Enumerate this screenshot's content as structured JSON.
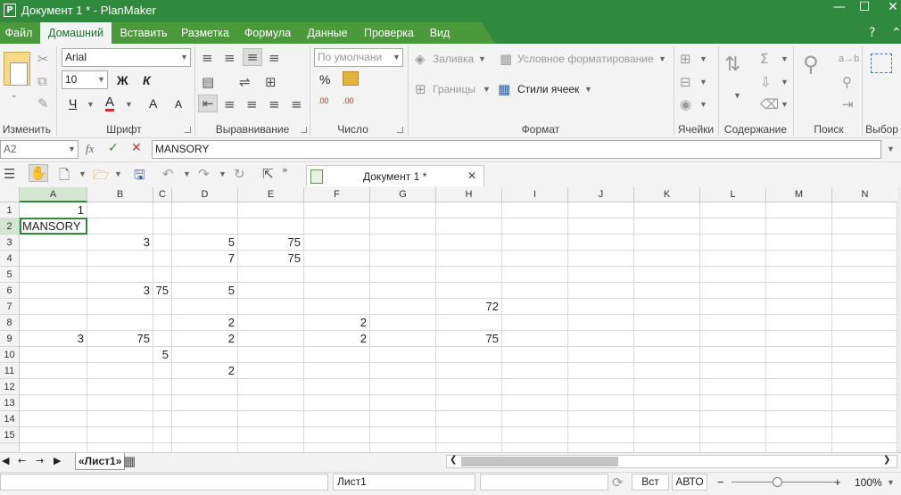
{
  "window": {
    "title": "Документ 1 * - PlanMaker",
    "app_icon": "P",
    "minimize_glyph": "—",
    "maximize_glyph": "☐",
    "close_glyph": "✕"
  },
  "menu": {
    "items": [
      "Файл",
      "Домашний",
      "Вставить",
      "Разметка",
      "Формула",
      "Данные",
      "Проверка",
      "Вид"
    ],
    "active": "Домашний",
    "help_glyph": "?",
    "collapse_glyph": "⌃"
  },
  "ribbon": {
    "groups": [
      "Изменить",
      "Шрифт",
      "Выравнивание",
      "Число",
      "Формат",
      "Ячейки",
      "Содержание",
      "Поиск",
      "Выбор"
    ],
    "font_name": "Arial",
    "font_size": "10",
    "bold_label": "Ж",
    "italic_label": "К",
    "underline_label": "Ч",
    "font_color_label": "A",
    "grow_font_label": "A",
    "shrink_font_label": "A",
    "number_format": "По умолчани",
    "percent_label": "%",
    "fill_label": "Заливка",
    "conditional_label": "Условное форматирование",
    "borders_label": "Границы",
    "cell_styles_label": "Стили ячеек",
    "search_replace_label": "a→b",
    "accent_color": "#2f8a3e"
  },
  "formula_bar": {
    "cell_ref": "A2",
    "fx_label": "fx",
    "content": "MANSORY"
  },
  "document_tab": {
    "title": "Документ 1 *",
    "close_glyph": "✕"
  },
  "sheet": {
    "columns": [
      "A",
      "B",
      "C",
      "D",
      "E",
      "F",
      "G",
      "H",
      "I",
      "J",
      "K",
      "L",
      "M",
      "N"
    ],
    "rows": [
      "1",
      "2",
      "3",
      "4",
      "5",
      "6",
      "7",
      "8",
      "9",
      "10",
      "11",
      "12",
      "13",
      "14",
      "15"
    ],
    "selected_column": "A",
    "selected_row": "2",
    "cells": [
      {
        "col": "A",
        "row": 1,
        "value": "1"
      },
      {
        "col": "A",
        "row": 2,
        "value": "MANSORY"
      },
      {
        "col": "B",
        "row": 3,
        "value": "3"
      },
      {
        "col": "D",
        "row": 3,
        "value": "5"
      },
      {
        "col": "E",
        "row": 3,
        "value": "75"
      },
      {
        "col": "D",
        "row": 4,
        "value": "7"
      },
      {
        "col": "E",
        "row": 4,
        "value": "75"
      },
      {
        "col": "B",
        "row": 6,
        "value": "3"
      },
      {
        "col": "C",
        "row": 6,
        "value": "75"
      },
      {
        "col": "D",
        "row": 6,
        "value": "5"
      },
      {
        "col": "H",
        "row": 7,
        "value": "72"
      },
      {
        "col": "D",
        "row": 8,
        "value": "2"
      },
      {
        "col": "F",
        "row": 8,
        "value": "2"
      },
      {
        "col": "A",
        "row": 9,
        "value": "3"
      },
      {
        "col": "B",
        "row": 9,
        "value": "75"
      },
      {
        "col": "D",
        "row": 9,
        "value": "2"
      },
      {
        "col": "F",
        "row": 9,
        "value": "2"
      },
      {
        "col": "H",
        "row": 9,
        "value": "75"
      },
      {
        "col": "C",
        "row": 10,
        "value": "5"
      },
      {
        "col": "D",
        "row": 11,
        "value": "2"
      }
    ]
  },
  "sheet_tabs": {
    "tabs": [
      "«Лист1»"
    ],
    "active": "«Лист1»"
  },
  "statusbar": {
    "sheet_name": "Лист1",
    "insert_mode": "Вст",
    "calc_mode": "АВТО",
    "zoom": "100%",
    "zoom_out": "−",
    "zoom_in": "+"
  }
}
